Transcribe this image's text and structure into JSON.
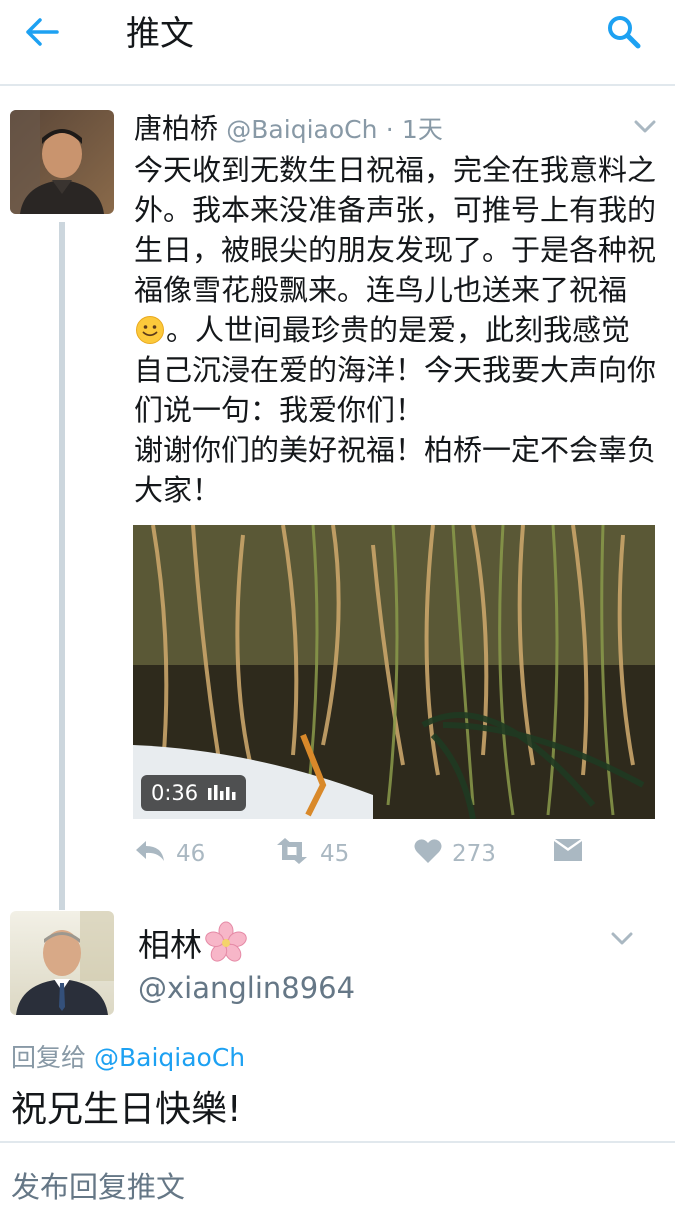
{
  "header": {
    "title": "推文",
    "back_icon": "arrow-left-icon",
    "search_icon": "search-icon",
    "accent_color": "#1da1f2"
  },
  "main_tweet": {
    "author_name": "唐柏桥",
    "handle": "@BaiqiaoCh",
    "separator": "·",
    "time": "1天",
    "text_part1": "今天收到无数生日祝福，完全在我意料之外。我本来没准备声张，可推号上有我的生日，被眼尖的朋友发现了。于是各种祝福像雪花般飘来。连鸟儿也送来了祝福",
    "text_part2": "。人世间最珍贵的是爱，此刻我感觉自己沉浸在爱的海洋！今天我要大声向你们说一句：我爱你们！\n谢谢你们的美好祝福！柏桥一定不会辜负大家！",
    "emoji": "smiling-face-icon",
    "video_duration": "0:36",
    "actions": {
      "reply_count": "46",
      "retweet_count": "45",
      "like_count": "273"
    }
  },
  "reply_tweet": {
    "author_name": "相林",
    "name_emoji": "cherry-blossom-icon",
    "handle": "@xianglin8964",
    "reply_to_label": "回复给",
    "reply_to_handle": "@BaiqiaoCh",
    "text": "祝兄生日快樂!"
  },
  "compose": {
    "placeholder": "发布回复推文"
  }
}
